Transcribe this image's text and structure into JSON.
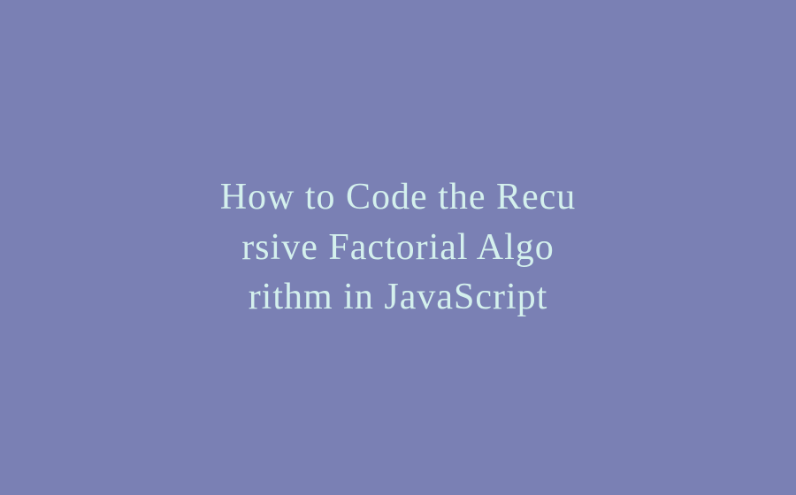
{
  "title": {
    "line1": "How to Code the Recu",
    "line2": "rsive Factorial Algo",
    "line3": "rithm in JavaScript"
  }
}
